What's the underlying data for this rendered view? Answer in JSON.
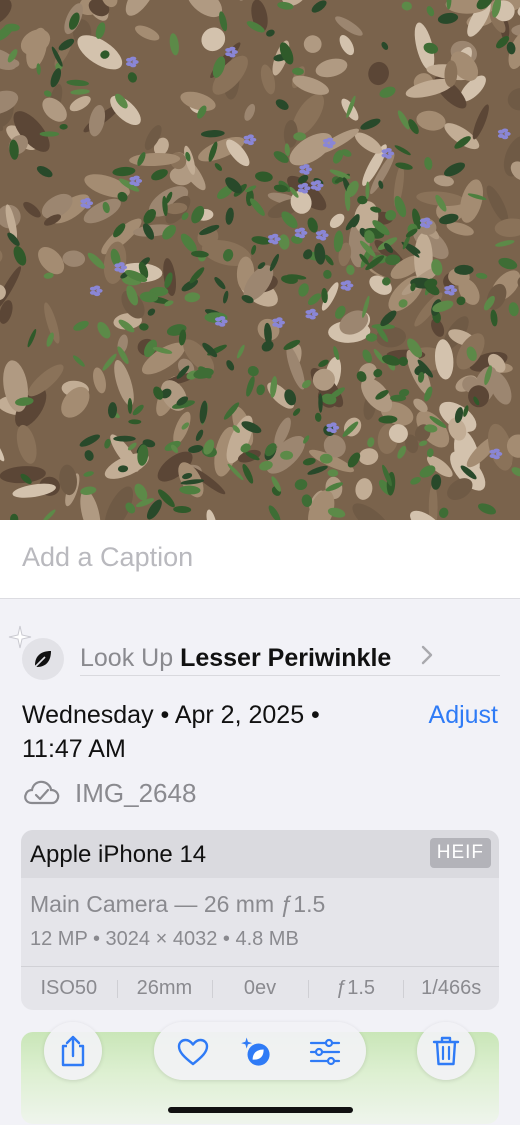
{
  "photo": {
    "subject": "Lesser Periwinkle groundcover among dry leaves"
  },
  "caption": {
    "placeholder": "Add a Caption"
  },
  "lookup": {
    "prefix": "Look Up",
    "subject": "Lesser Periwinkle"
  },
  "date": {
    "line1": "Wednesday • Apr 2, 2025 •",
    "line2": "11:47 AM",
    "adjust_label": "Adjust"
  },
  "file": {
    "name": "IMG_2648"
  },
  "camera": {
    "device": "Apple iPhone 14",
    "format": "HEIF",
    "lens": "Main Camera — 26 mm ƒ1.5",
    "specs": "12 MP • 3024 × 4032 • 4.8 MB",
    "exif": [
      "ISO50",
      "26mm",
      "0ev",
      "ƒ1.5",
      "1/466s"
    ]
  },
  "toolbar": {
    "icons": [
      "share-icon",
      "heart-icon",
      "visual-lookup-icon",
      "adjust-sliders-icon",
      "trash-icon"
    ]
  },
  "colors": {
    "accent": "#2f7bf6",
    "background": "#f2f2f7",
    "secondary_text": "#8a8a8f"
  }
}
